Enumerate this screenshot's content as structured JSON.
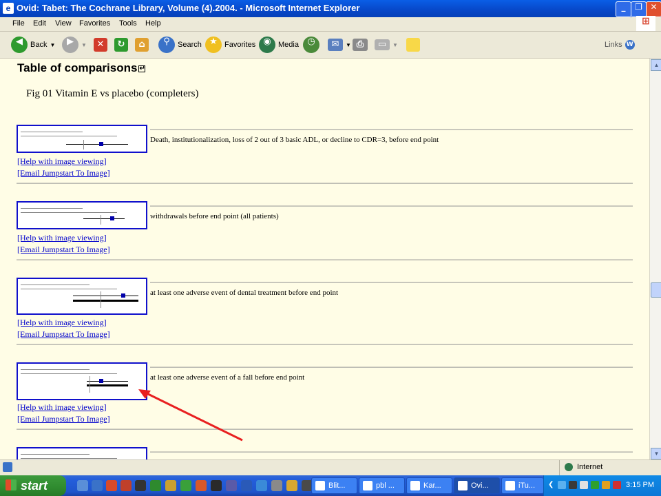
{
  "window": {
    "title": "Ovid: Tabet: The Cochrane Library, Volume (4).2004. - Microsoft Internet Explorer"
  },
  "menu": [
    "File",
    "Edit",
    "View",
    "Favorites",
    "Tools",
    "Help"
  ],
  "toolbar": {
    "back": "Back",
    "search": "Search",
    "favorites": "Favorites",
    "media": "Media",
    "links": "Links"
  },
  "page": {
    "heading": "Table of comparisons",
    "figure_title": "Fig 01 Vitamin E vs placebo (completers)",
    "help_link": "[Help with image viewing]",
    "email_link": "[Email Jumpstart To Image]",
    "outcomes": [
      {
        "label": "Death, institutionalization, loss of 2 out of 3 basic ADL, or decline to CDR=3, before end point"
      },
      {
        "label": "withdrawals before end point (all patients)"
      },
      {
        "label": "at least one adverse event of dental treatment before end point"
      },
      {
        "label": "at least one adverse event of a fall before end point"
      }
    ]
  },
  "status": {
    "zone": "Internet"
  },
  "taskbar": {
    "start": "start",
    "items": [
      "Blit...",
      "pbl ...",
      "Kar...",
      "Ovi...",
      "iTu..."
    ],
    "clock": "3:15 PM"
  }
}
